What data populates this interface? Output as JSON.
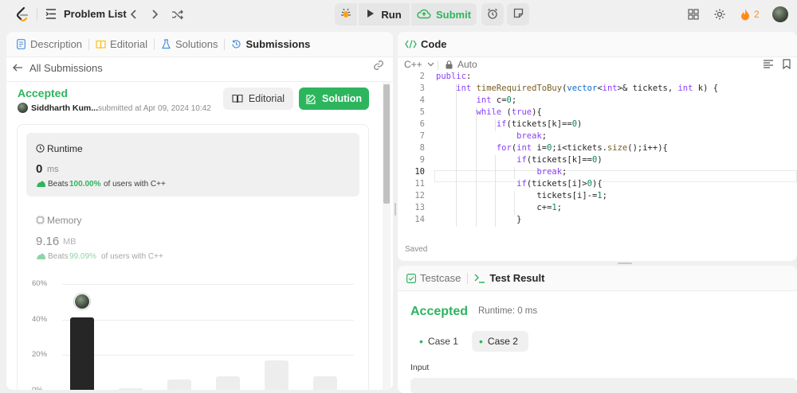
{
  "topbar": {
    "problem_list": "Problem List",
    "run": "Run",
    "submit": "Submit",
    "streak": "2"
  },
  "left": {
    "tabs": [
      {
        "label": "Description"
      },
      {
        "label": "Editorial"
      },
      {
        "label": "Solutions"
      },
      {
        "label": "Submissions"
      }
    ],
    "all_submissions": "All Submissions",
    "status": "Accepted",
    "user": "Siddharth Kum...",
    "submitted": "submitted at Apr 09, 2024 10:42",
    "editorial_btn": "Editorial",
    "solution_btn": "Solution",
    "runtime": {
      "label": "Runtime",
      "value": "0",
      "unit": "ms",
      "beats_pre": "Beats",
      "beats_pct": "100.00%",
      "beats_post": "of users with C++"
    },
    "memory": {
      "label": "Memory",
      "value": "9.16",
      "unit": "MB",
      "beats_pre": "Beats",
      "beats_pct": "99.09%",
      "beats_post": "of users with C++"
    }
  },
  "chart_data": {
    "type": "bar",
    "yticks": [
      "60%",
      "40%",
      "20%",
      "0%"
    ],
    "ylim": [
      0,
      60
    ],
    "values": [
      41,
      1,
      6,
      8,
      17,
      8
    ],
    "highlight_index": 0,
    "colors": {
      "highlight": "#262626",
      "bar": "#ededed",
      "accepted": "#2db55d"
    }
  },
  "code": {
    "title": "Code",
    "language": "C++",
    "mode": "Auto",
    "saved": "Saved",
    "lines": [
      {
        "n": "2",
        "t": "public:"
      },
      {
        "n": "3",
        "t": "    int timeRequiredToBuy(vector<int>& tickets, int k) {"
      },
      {
        "n": "4",
        "t": "        int c=0;"
      },
      {
        "n": "5",
        "t": "        while (true){"
      },
      {
        "n": "6",
        "t": "            if(tickets[k]==0)"
      },
      {
        "n": "7",
        "t": "                break;"
      },
      {
        "n": "8",
        "t": "            for(int i=0;i<tickets.size();i++){"
      },
      {
        "n": "9",
        "t": "                if(tickets[k]==0)"
      },
      {
        "n": "10",
        "t": "                    break;"
      },
      {
        "n": "11",
        "t": "                if(tickets[i]>0){"
      },
      {
        "n": "12",
        "t": "                    tickets[i]-=1;"
      },
      {
        "n": "13",
        "t": "                    c+=1;"
      },
      {
        "n": "14",
        "t": "                }"
      }
    ]
  },
  "test": {
    "tab_testcase": "Testcase",
    "tab_result": "Test Result",
    "status": "Accepted",
    "runtime": "Runtime: 0 ms",
    "case1": "Case 1",
    "case2": "Case 2",
    "input_label": "Input"
  }
}
